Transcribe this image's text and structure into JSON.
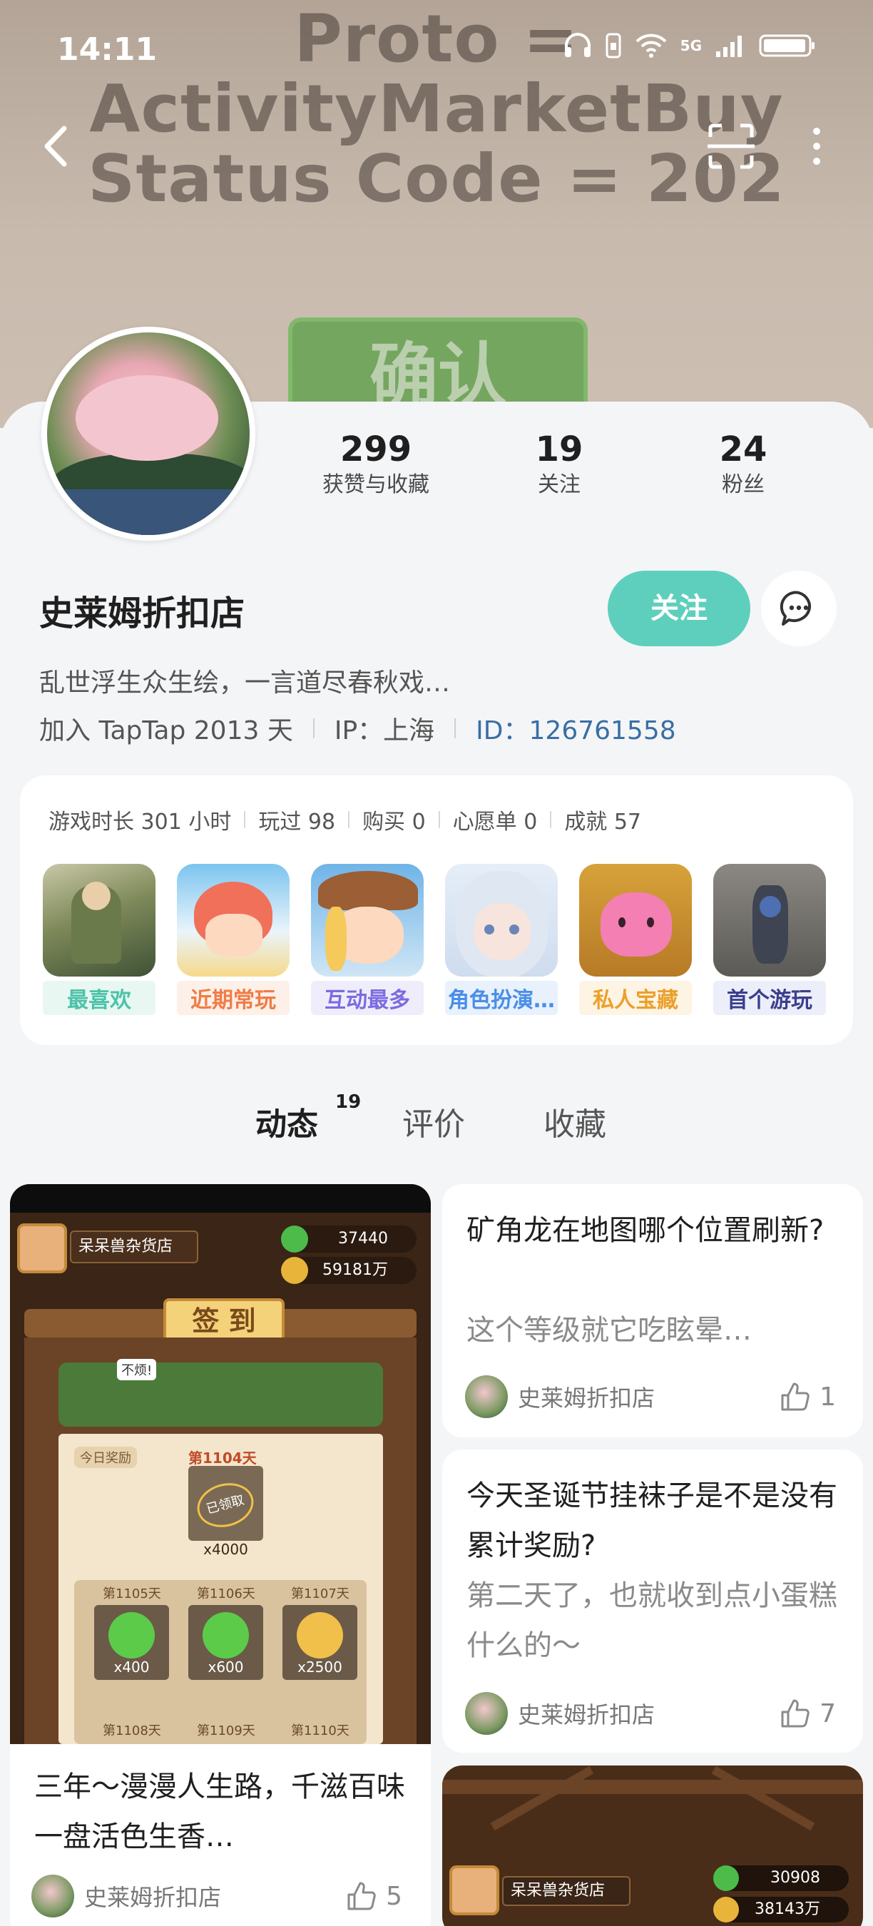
{
  "status_bar": {
    "time": "14:11",
    "network": "5G"
  },
  "banner": {
    "text_lines": [
      "Proto =",
      "ActivityMarketBuy",
      "Status Code = 202"
    ],
    "button_text": "确认"
  },
  "profile": {
    "username": "史莱姆折扣店",
    "stats": [
      {
        "value": "299",
        "label": "获赞与收藏"
      },
      {
        "value": "19",
        "label": "关注"
      },
      {
        "value": "24",
        "label": "粉丝"
      }
    ],
    "follow_label": "关注",
    "bio": "乱世浮生众生绘，一言道尽春秋戏…",
    "joined": "加入 TapTap 2013 天",
    "ip": "IP：上海",
    "id": "ID：126761558"
  },
  "game_stats": {
    "items": [
      "游戏时长 301 小时",
      "玩过 98",
      "购买 0",
      "心愿单 0",
      "成就 57"
    ]
  },
  "games": [
    {
      "tag": "最喜欢",
      "color": "#4cc3a8",
      "bg": "#e8f7f2"
    },
    {
      "tag": "近期常玩",
      "color": "#f07c46",
      "bg": "#fdf0e8"
    },
    {
      "tag": "互动最多",
      "color": "#7b6be0",
      "bg": "#efedfb"
    },
    {
      "tag": "角色扮演…",
      "color": "#4a8ee8",
      "bg": "#e8f1fc"
    },
    {
      "tag": "私人宝藏",
      "color": "#eca02c",
      "bg": "#fdf4e4"
    },
    {
      "tag": "首个游玩",
      "color": "#3a3f8c",
      "bg": "#eceefa"
    }
  ],
  "tabs": [
    {
      "label": "动态",
      "count": "19",
      "active": true
    },
    {
      "label": "评价"
    },
    {
      "label": "收藏"
    }
  ],
  "posts": {
    "left_1": {
      "shop_name": "呆呆兽杂货店",
      "currency_1": "37440",
      "currency_2": "59181万",
      "banner": "签 到",
      "bubble": "不烦!",
      "today_label": "今日奖励",
      "today_day": "第1104天",
      "today_stamp": "已领取",
      "today_amount": "x4000",
      "days": [
        {
          "day": "第1105天",
          "amount": "x400"
        },
        {
          "day": "第1106天",
          "amount": "x600"
        },
        {
          "day": "第1107天",
          "amount": "x2500"
        }
      ],
      "next_days": [
        "第1108天",
        "第1109天",
        "第1110天"
      ],
      "title": "三年～漫漫人生路，千滋百味一盘活色生香…",
      "author": "史莱姆折扣店",
      "likes": "5"
    },
    "right_1": {
      "title": "矿角龙在地图哪个位置刷新?",
      "sub": "这个等级就它吃眩晕…",
      "author": "史莱姆折扣店",
      "likes": "1"
    },
    "right_2": {
      "title": "今天圣诞节挂袜子是不是没有累计奖励?",
      "sub": "第二天了，也就收到点小蛋糕什么的～",
      "author": "史莱姆折扣店",
      "likes": "7"
    },
    "right_3": {
      "shop_name": "呆呆兽杂货店",
      "currency_1": "30908",
      "currency_2": "38143万"
    }
  }
}
